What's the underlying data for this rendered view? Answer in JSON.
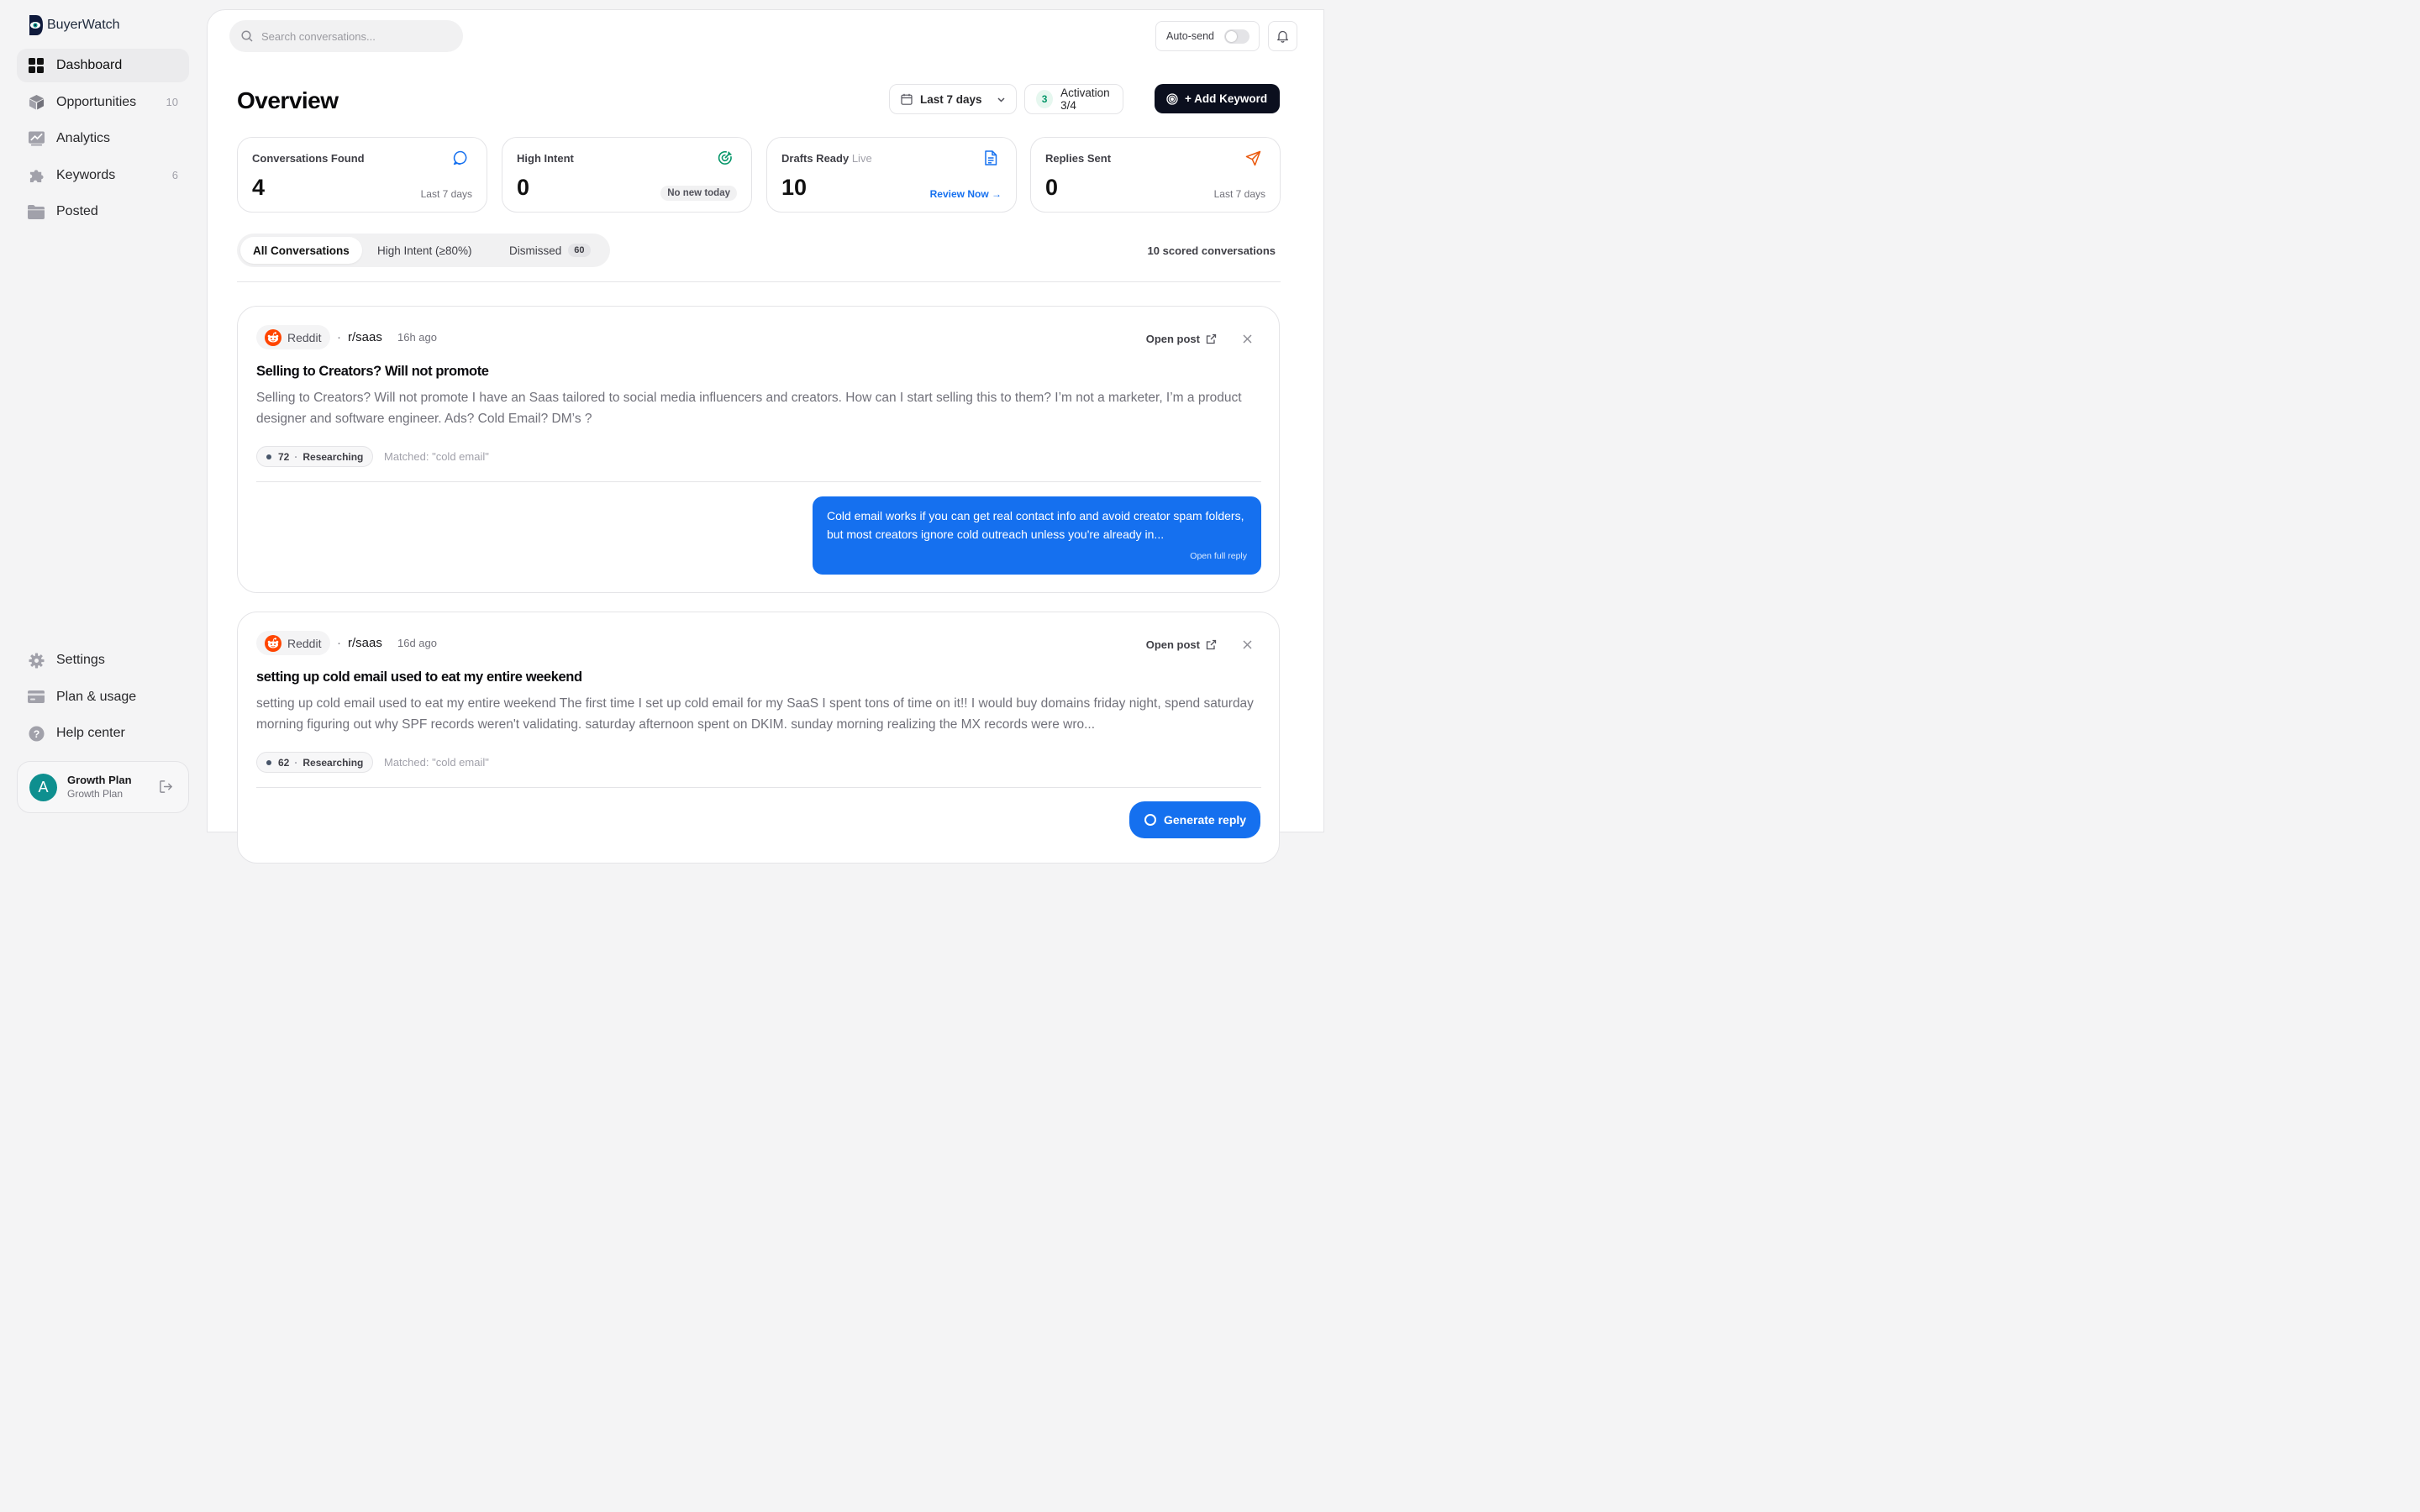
{
  "app": {
    "name": "BuyerWatch"
  },
  "sidebar": {
    "nav": [
      {
        "label": "Dashboard",
        "icon": "grid-icon",
        "count": ""
      },
      {
        "label": "Opportunities",
        "icon": "cube-icon",
        "count": "10"
      },
      {
        "label": "Analytics",
        "icon": "chart-icon",
        "count": ""
      },
      {
        "label": "Keywords",
        "icon": "puzzle-icon",
        "count": "6"
      },
      {
        "label": "Posted",
        "icon": "folder-icon",
        "count": ""
      }
    ],
    "bottom_nav": [
      {
        "label": "Settings",
        "icon": "gear-icon"
      },
      {
        "label": "Plan & usage",
        "icon": "card-icon"
      },
      {
        "label": "Help center",
        "icon": "help-icon"
      }
    ],
    "profile": {
      "initial": "A",
      "name": "Growth Plan",
      "plan": "Growth Plan"
    }
  },
  "header": {
    "search_placeholder": "Search conversations...",
    "autosend_label": "Auto-send",
    "autosend_on": false
  },
  "overview": {
    "title": "Overview",
    "range_label": "Last 7 days",
    "activation_count": "3",
    "activation_label": "Activation 3/4",
    "add_keyword_label": "+ Add Keyword"
  },
  "stats": [
    {
      "label": "Conversations Found",
      "label_extra": "",
      "value": "4",
      "sub": "Last 7 days",
      "icon": "chat-bubble-icon",
      "icon_color": "#1570ef"
    },
    {
      "label": "High Intent",
      "label_extra": "",
      "value": "0",
      "sub": "No new today",
      "icon": "target-icon",
      "icon_color": "#059669"
    },
    {
      "label": "Drafts Ready",
      "label_extra": "Live",
      "value": "10",
      "sub": "Review Now →",
      "icon": "document-icon",
      "icon_color": "#1570ef"
    },
    {
      "label": "Replies Sent",
      "label_extra": "",
      "value": "0",
      "sub": "Last 7 days",
      "icon": "send-icon",
      "icon_color": "#ea580c"
    }
  ],
  "tabs": [
    {
      "label": "All Conversations",
      "badge": "",
      "active": true
    },
    {
      "label": "High Intent (≥80%)",
      "badge": "",
      "active": false
    },
    {
      "label": "Dismissed",
      "badge": "60",
      "active": false
    }
  ],
  "scored_label": "10 scored conversations",
  "conversations": [
    {
      "source": "Reddit",
      "subreddit": "r/saas",
      "ago": "16h ago",
      "open_post": "Open post",
      "title": "Selling to Creators? Will not promote",
      "body": "Selling to Creators? Will not promote I have an Saas tailored to social media influencers and creators. How can I start selling this to them? I’m not a marketer, I’m a product designer and software engineer. Ads? Cold Email? DM’s ?",
      "score": "72",
      "stage": "Researching",
      "matched": "Matched: \"cold email\"",
      "reply": "Cold email works if you can get real contact info and avoid creator spam folders, but most creators ignore cold outreach unless you're already in...",
      "reply_link": "Open full reply"
    },
    {
      "source": "Reddit",
      "subreddit": "r/saas",
      "ago": "16d ago",
      "open_post": "Open post",
      "title": "setting up cold email used to eat my entire weekend",
      "body": "setting up cold email used to eat my entire weekend The first time I set up cold email for my SaaS I spent tons of time on it!! I would buy domains friday night, spend saturday morning figuring out why SPF records weren't validating. saturday afternoon spent on DKIM. sunday morning realizing the MX records were wro...",
      "score": "62",
      "stage": "Researching",
      "matched": "Matched: \"cold email\"",
      "action_label": "Generate reply"
    }
  ]
}
